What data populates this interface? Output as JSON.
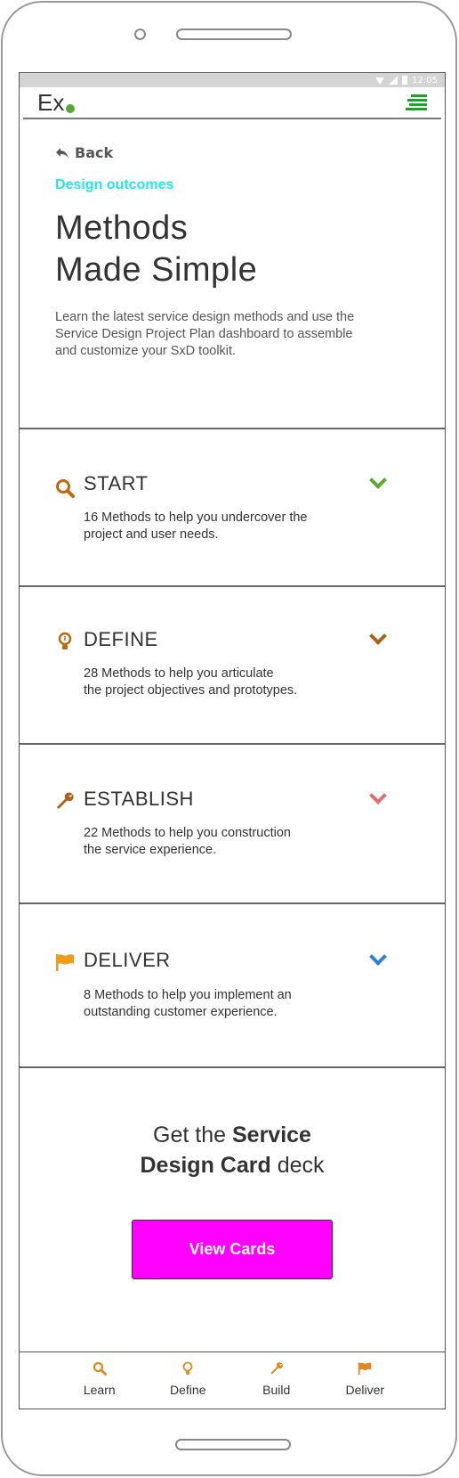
{
  "status_bar": {
    "time": "12:05"
  },
  "header": {
    "logo_text": "Ex"
  },
  "hero": {
    "back_label": "Back",
    "eyebrow": "Design outcomes",
    "title_line1": "Methods",
    "title_line2": "Made Simple",
    "description": "Learn the latest service design methods and use the Service Design Project Plan dashboard to assemble and customize your SxD toolkit."
  },
  "phases": [
    {
      "title": "START",
      "description_line1": "16 Methods to help you undercover the",
      "description_line2": "project and user needs.",
      "icon": "search-icon",
      "icon_color": "#c0690d",
      "chevron_color": "#5aa832"
    },
    {
      "title": "DEFINE",
      "description_line1": "28 Methods to help you articulate",
      "description_line2": "the project objectives and prototypes.",
      "icon": "lightbulb-icon",
      "icon_color": "#b86a12",
      "chevron_color": "#a9631a"
    },
    {
      "title": "ESTABLISH",
      "description_line1": "22 Methods to help you construction",
      "description_line2": "the service experience.",
      "icon": "wrench-icon",
      "icon_color": "#b0601a",
      "chevron_color": "#e07070"
    },
    {
      "title": "DELIVER",
      "description_line1": "8 Methods to help you implement an",
      "description_line2": "outstanding customer experience.",
      "icon": "flag-icon",
      "icon_color": "#f29a1a",
      "chevron_color": "#2f7fe0"
    }
  ],
  "cta": {
    "heading_part1": "Get the ",
    "heading_bold1": "Service",
    "heading_bold2": "Design Card",
    "heading_part2": " deck",
    "button_label": "View Cards"
  },
  "bottom_nav": [
    {
      "label": "Learn",
      "icon": "search-icon"
    },
    {
      "label": "Define",
      "icon": "lightbulb-icon"
    },
    {
      "label": "Build",
      "icon": "wrench-icon"
    },
    {
      "label": "Deliver",
      "icon": "flag-icon"
    }
  ],
  "colors": {
    "accent_cyan": "#22e6f0",
    "cta_magenta": "#ff00ff",
    "logo_dot_green": "#5aa832",
    "menu_green": "#1aa32a",
    "nav_icon_orange": "#e08a20"
  }
}
